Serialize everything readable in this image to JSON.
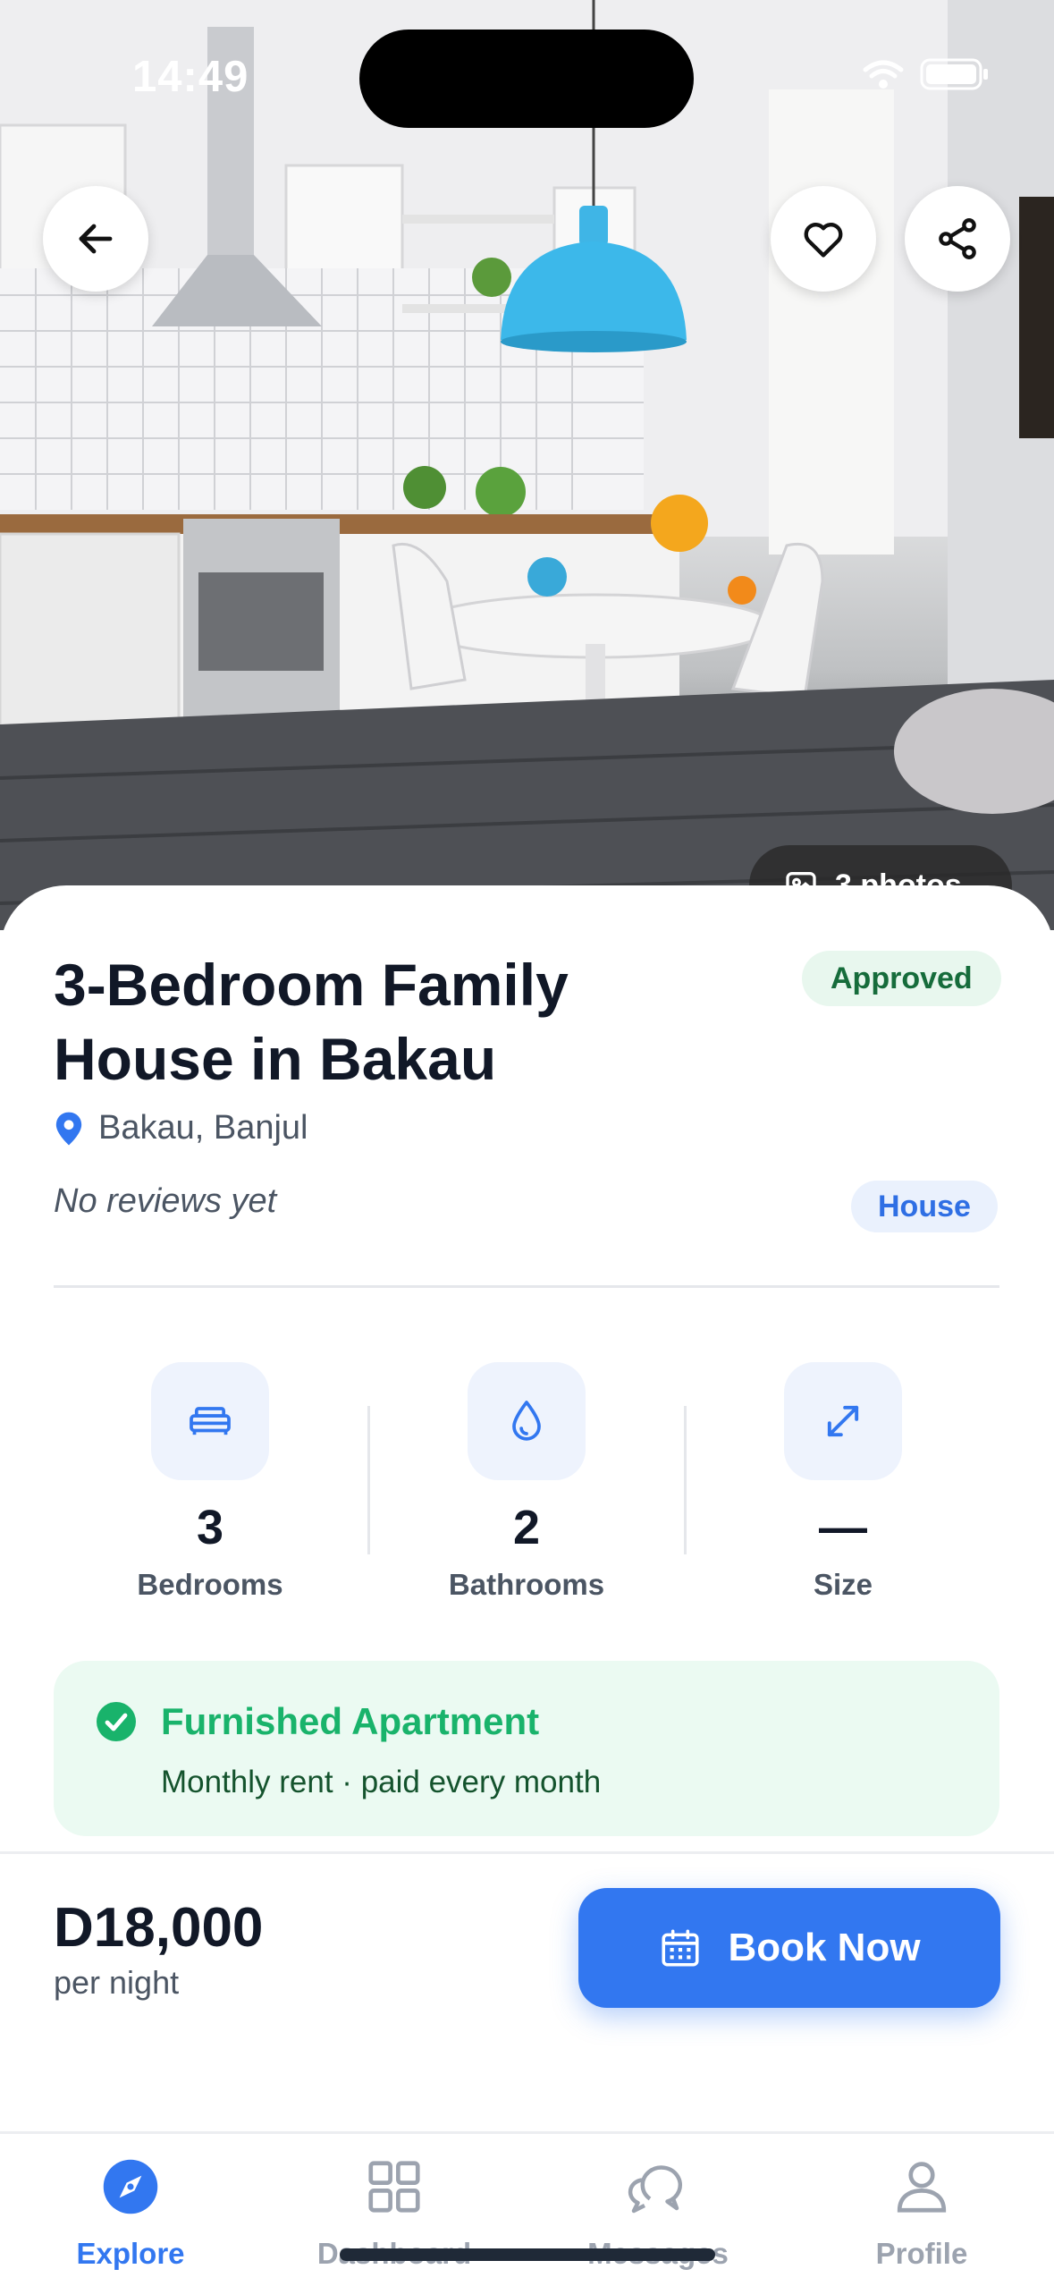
{
  "status_bar": {
    "time": "14:49"
  },
  "hero": {
    "photos_label": "3 photos",
    "icons": {
      "back": "arrow-left-icon",
      "favorite": "heart-icon",
      "share": "share-icon",
      "photos": "image-icon"
    }
  },
  "listing": {
    "title_line1": "3-Bedroom Family",
    "title_line2": "House in Bakau",
    "status": "Approved",
    "location": "Bakau, Banjul",
    "reviews": "No reviews yet",
    "type": "House"
  },
  "stats": [
    {
      "value": "3",
      "label": "Bedrooms",
      "icon": "bed-icon"
    },
    {
      "value": "2",
      "label": "Bathrooms",
      "icon": "water-drop-icon"
    },
    {
      "value": "—",
      "label": "Size",
      "icon": "expand-arrows-icon"
    }
  ],
  "furnished": {
    "title": "Furnished Apartment",
    "subtitle": "Monthly rent · paid every month"
  },
  "booking": {
    "price": "D18,000",
    "unit": "per night",
    "button_label": "Book Now"
  },
  "tabs": [
    {
      "label": "Explore",
      "icon": "compass-icon",
      "active": true
    },
    {
      "label": "Dashboard",
      "icon": "grid-icon",
      "active": false
    },
    {
      "label": "Messages",
      "icon": "chat-bubbles-icon",
      "active": false
    },
    {
      "label": "Profile",
      "icon": "user-icon",
      "active": false
    }
  ],
  "colors": {
    "accent": "#3277f0",
    "success": "#19b36b",
    "approved_bg": "#e8f7ee",
    "approved_text": "#166c3b",
    "card_bg": "#ebfaf2",
    "inactive": "#9ca3af"
  }
}
